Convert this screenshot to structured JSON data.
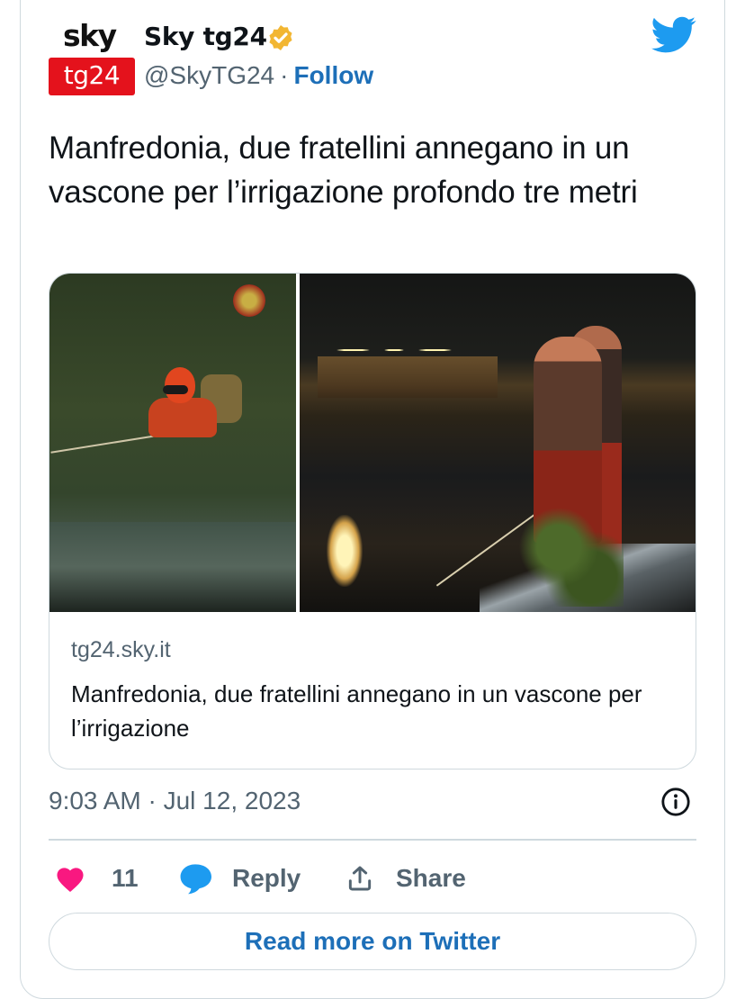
{
  "author": {
    "logo_wordmark": "sky",
    "logo_badge": "tg24",
    "name": "Sky tg24",
    "handle": "@SkyTG24",
    "separator": "·",
    "follow_label": "Follow",
    "verified_badge_color": "#f2b632"
  },
  "tweet": {
    "text": "Manfredonia, due fratellini annegano in un vascone per l’irrigazione profondo tre metri",
    "timestamp": "9:03 AM · Jul 12, 2023"
  },
  "link_card": {
    "domain": "tg24.sky.it",
    "title": "Manfredonia, due fratellini annegano in un vascone per l’irrigazione",
    "images": [
      "diver-in-pool-photo",
      "rescuers-at-night-photo"
    ]
  },
  "actions": {
    "like_count": "11",
    "reply_label": "Reply",
    "share_label": "Share"
  },
  "read_more_label": "Read more on Twitter",
  "colors": {
    "twitter_blue": "#1d9bf0",
    "link_blue": "#1d6fb8",
    "like_pink": "#f91880",
    "secondary_text": "#536471",
    "border": "#cfd9de",
    "brand_red": "#e4121c"
  },
  "icons": [
    "twitter-bird-icon",
    "verified-badge-icon",
    "info-icon",
    "heart-icon",
    "reply-bubble-icon",
    "share-icon"
  ]
}
